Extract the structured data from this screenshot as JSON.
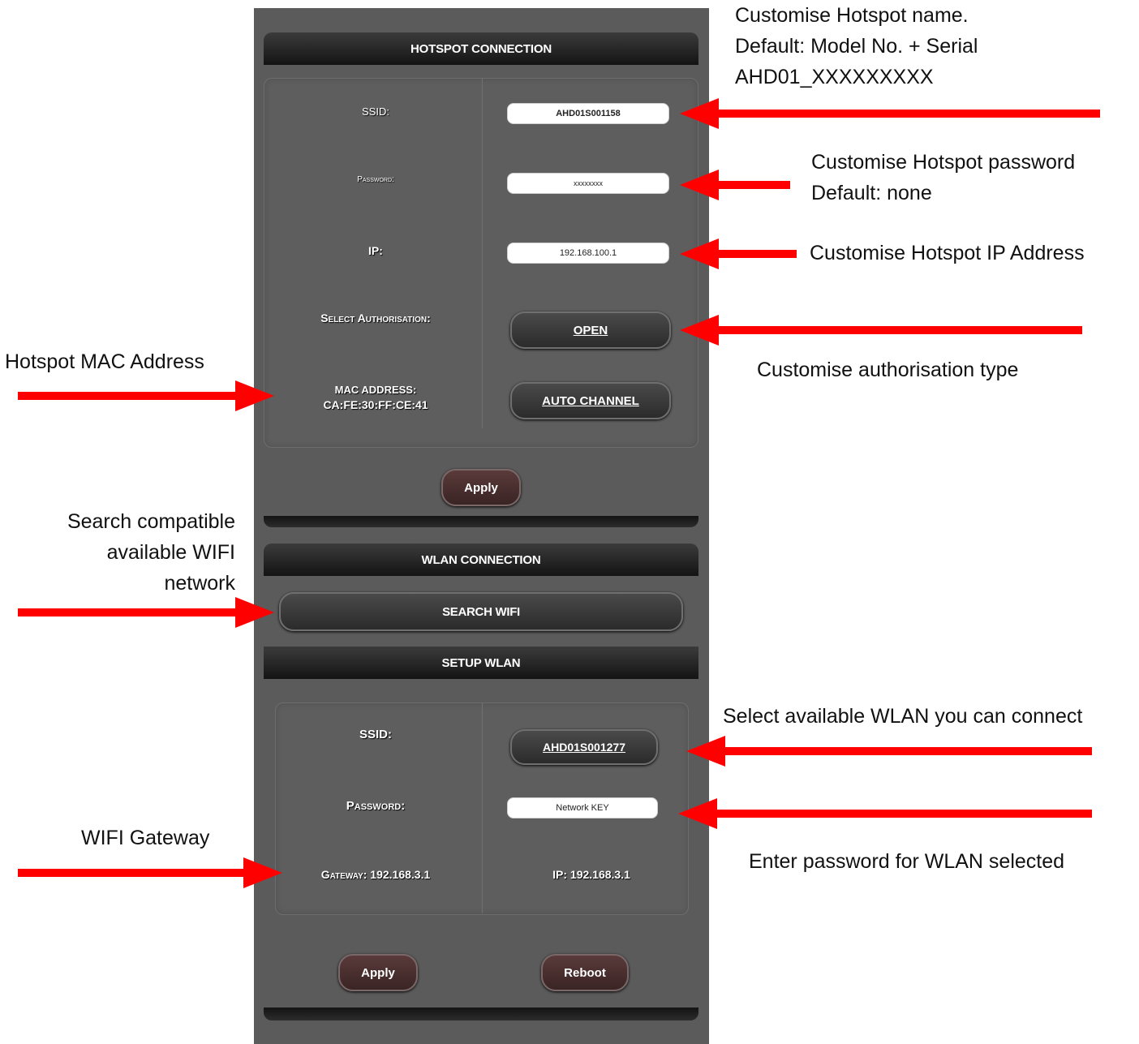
{
  "hotspot": {
    "header": "HOTSPOT CONNECTION",
    "ssid_label": "SSID:",
    "ssid_value": "AHD01S001158",
    "password_label": "Password:",
    "password_value": "xxxxxxxx",
    "ip_label": "IP:",
    "ip_value": "192.168.100.1",
    "auth_label": "Select Authorisation:",
    "auth_button": "OPEN",
    "mac_label": "MAC ADDRESS:",
    "mac_value": "CA:FE:30:FF:CE:41",
    "channel_button": "AUTO CHANNEL",
    "apply_button": "Apply"
  },
  "wlan": {
    "header": "WLAN CONNECTION",
    "search_button": "SEARCH WIFI",
    "setup_header": "SETUP WLAN",
    "ssid_label": "SSID:",
    "ssid_button": "AHD01S001277",
    "password_label": "Password:",
    "password_value": "Network KEY",
    "gateway_label": "Gateway: 192.168.3.1",
    "ip_label": "IP: 192.168.3.1",
    "apply_button": "Apply",
    "reboot_button": "Reboot"
  },
  "annotations": {
    "hotspot_name": [
      "Customise Hotspot name.",
      "Default: Model No. + Serial",
      "AHD01_XXXXXXXXX"
    ],
    "hotspot_password": [
      "Customise Hotspot password",
      "Default: none"
    ],
    "hotspot_ip": "Customise Hotspot IP Address",
    "auth_type": "Customise authorisation type",
    "mac_address": "Hotspot MAC Address",
    "search_wifi": [
      "Search compatible",
      "available WIFI",
      "network"
    ],
    "select_wlan": "Select available WLAN you can connect",
    "wifi_gateway": "WIFI Gateway",
    "enter_password": "Enter password for WLAN selected"
  },
  "colors": {
    "arrow": "#ff0000",
    "panel": "#5c5b5b",
    "header": "#141414"
  }
}
